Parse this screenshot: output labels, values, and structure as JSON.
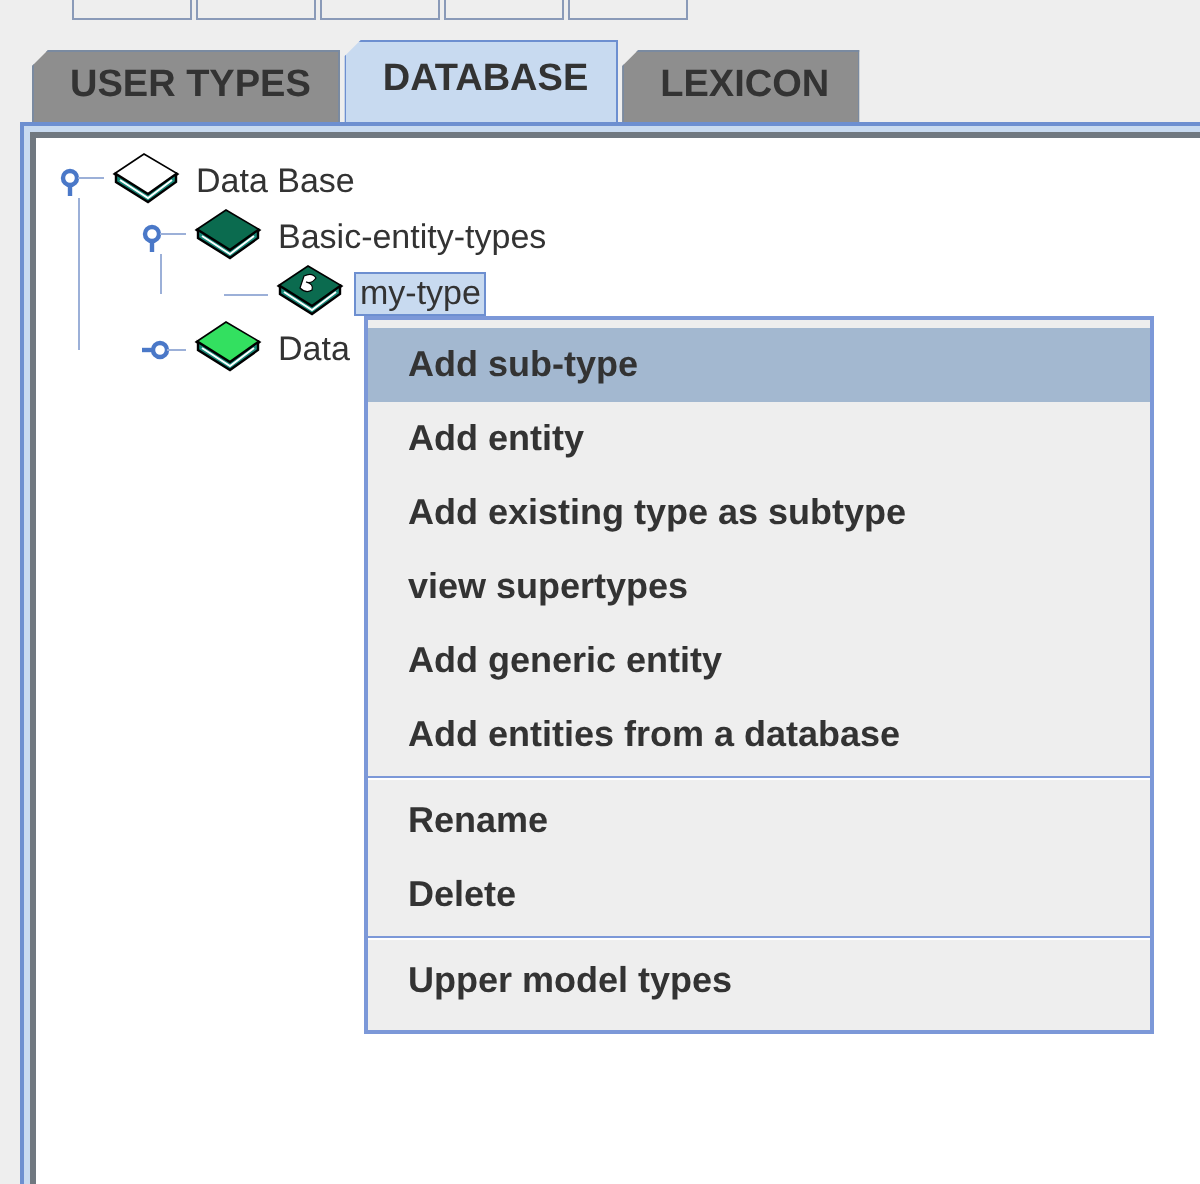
{
  "tabs": [
    {
      "label": "USER TYPES",
      "selected": false
    },
    {
      "label": "DATABASE",
      "selected": true
    },
    {
      "label": "LEXICON",
      "selected": false
    }
  ],
  "tree": [
    {
      "label": "Data Base",
      "color": "#ffffff",
      "expanded": true,
      "selected": false,
      "children": [
        {
          "label": "Basic-entity-types",
          "color": "#0b6b4f",
          "expanded": true,
          "selected": false,
          "children": [
            {
              "label": "my-type",
              "color": "#0b6b4f",
              "selected": true
            }
          ]
        },
        {
          "label": "Data",
          "color": "#33e060",
          "expanded": false,
          "selected": false
        }
      ]
    }
  ],
  "context_menu": {
    "groups": [
      [
        {
          "label": "Add sub-type",
          "selected": true
        },
        {
          "label": "Add entity",
          "selected": false
        },
        {
          "label": "Add existing type as subtype",
          "selected": false
        },
        {
          "label": "view supertypes",
          "selected": false
        },
        {
          "label": "Add generic entity",
          "selected": false
        },
        {
          "label": "Add entities from a database",
          "selected": false
        }
      ],
      [
        {
          "label": "Rename",
          "selected": false
        },
        {
          "label": "Delete",
          "selected": false
        }
      ],
      [
        {
          "label": "Upper model types",
          "selected": false
        }
      ]
    ]
  }
}
